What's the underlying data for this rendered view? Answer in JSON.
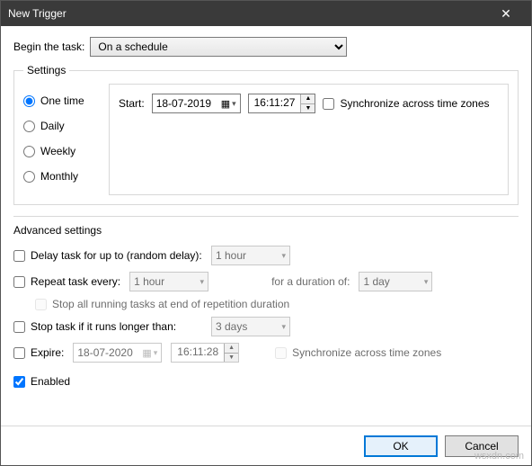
{
  "window": {
    "title": "New Trigger"
  },
  "begin": {
    "label": "Begin the task:",
    "selected": "On a schedule"
  },
  "settings": {
    "legend": "Settings",
    "radios": {
      "one_time": "One time",
      "daily": "Daily",
      "weekly": "Weekly",
      "monthly": "Monthly",
      "selected": "one_time"
    },
    "start_label": "Start:",
    "start_date": "18-07-2019",
    "start_time": "16:11:27",
    "sync_label": "Synchronize across time zones",
    "sync_checked": false
  },
  "advanced": {
    "legend": "Advanced settings",
    "delay": {
      "checked": false,
      "label": "Delay task for up to (random delay):",
      "value": "1 hour"
    },
    "repeat": {
      "checked": false,
      "label": "Repeat task every:",
      "value": "1 hour",
      "duration_label": "for a duration of:",
      "duration_value": "1 day"
    },
    "stop_end_repeat": {
      "checked": false,
      "label": "Stop all running tasks at end of repetition duration"
    },
    "stop_if_longer": {
      "checked": false,
      "label": "Stop task if it runs longer than:",
      "value": "3 days"
    },
    "expire": {
      "checked": false,
      "label": "Expire:",
      "date": "18-07-2020",
      "time": "16:11:28",
      "sync_label": "Synchronize across time zones",
      "sync_checked": false
    },
    "enabled": {
      "checked": true,
      "label": "Enabled"
    }
  },
  "buttons": {
    "ok": "OK",
    "cancel": "Cancel"
  },
  "watermark": "wsxdn.com"
}
